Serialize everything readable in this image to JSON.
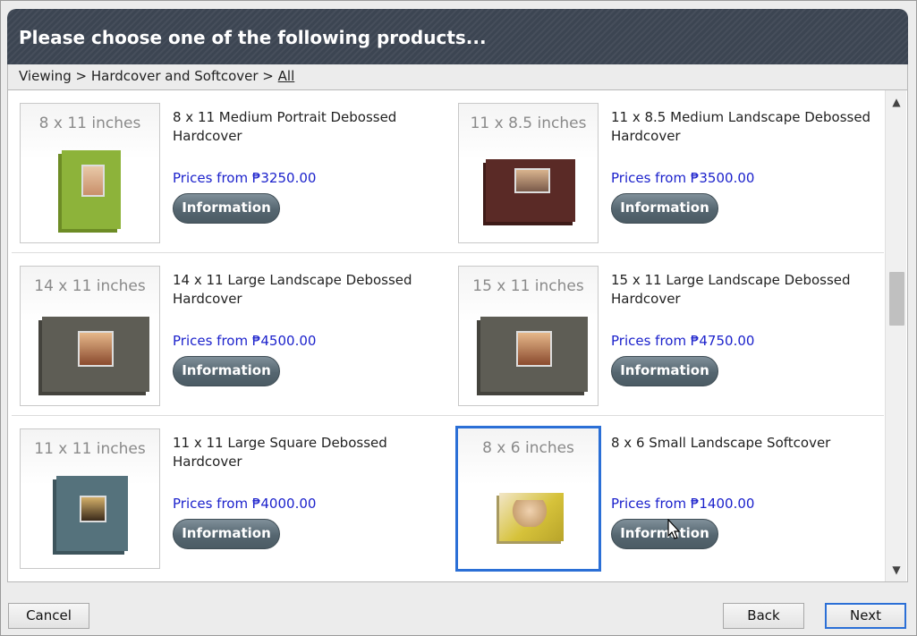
{
  "header": {
    "title": "Please choose one of the following products..."
  },
  "breadcrumb": {
    "prefix": "Viewing > Hardcover and Softcover > ",
    "current": "All"
  },
  "products": [
    {
      "size": "8 x 11 inches",
      "title": "8 x 11 Medium Portrait Debossed Hardcover",
      "price": "Prices from ₱3250.00",
      "info_label": "Information",
      "book_color": "#8db33a"
    },
    {
      "size": "11 x 8.5 inches",
      "title": "11 x 8.5 Medium Landscape Debossed Hardcover",
      "price": "Prices from ₱3500.00",
      "info_label": "Information",
      "book_color": "#5a2a26"
    },
    {
      "size": "14 x 11 inches",
      "title": "14 x 11 Large Landscape Debossed Hardcover",
      "price": "Prices from ₱4500.00",
      "info_label": "Information",
      "book_color": "#5e5d55"
    },
    {
      "size": "15 x 11 inches",
      "title": "15 x 11 Large Landscape Debossed Hardcover",
      "price": "Prices from ₱4750.00",
      "info_label": "Information",
      "book_color": "#5e5d55"
    },
    {
      "size": "11 x 11 inches",
      "title": "11 x 11 Large Square Debossed Hardcover",
      "price": "Prices from ₱4000.00",
      "info_label": "Information",
      "book_color": "#55727c"
    },
    {
      "size": "8 x 6 inches",
      "title": "8 x 6 Small Landscape Softcover",
      "price": "Prices from ₱1400.00",
      "info_label": "Information",
      "book_color": "#d6c23a",
      "selected": true
    }
  ],
  "footer": {
    "cancel_label": "Cancel",
    "back_label": "Back",
    "next_label": "Next"
  },
  "colors": {
    "accent": "#2b6fd6",
    "price": "#1c22cc",
    "header_bg": "#3c4552"
  }
}
